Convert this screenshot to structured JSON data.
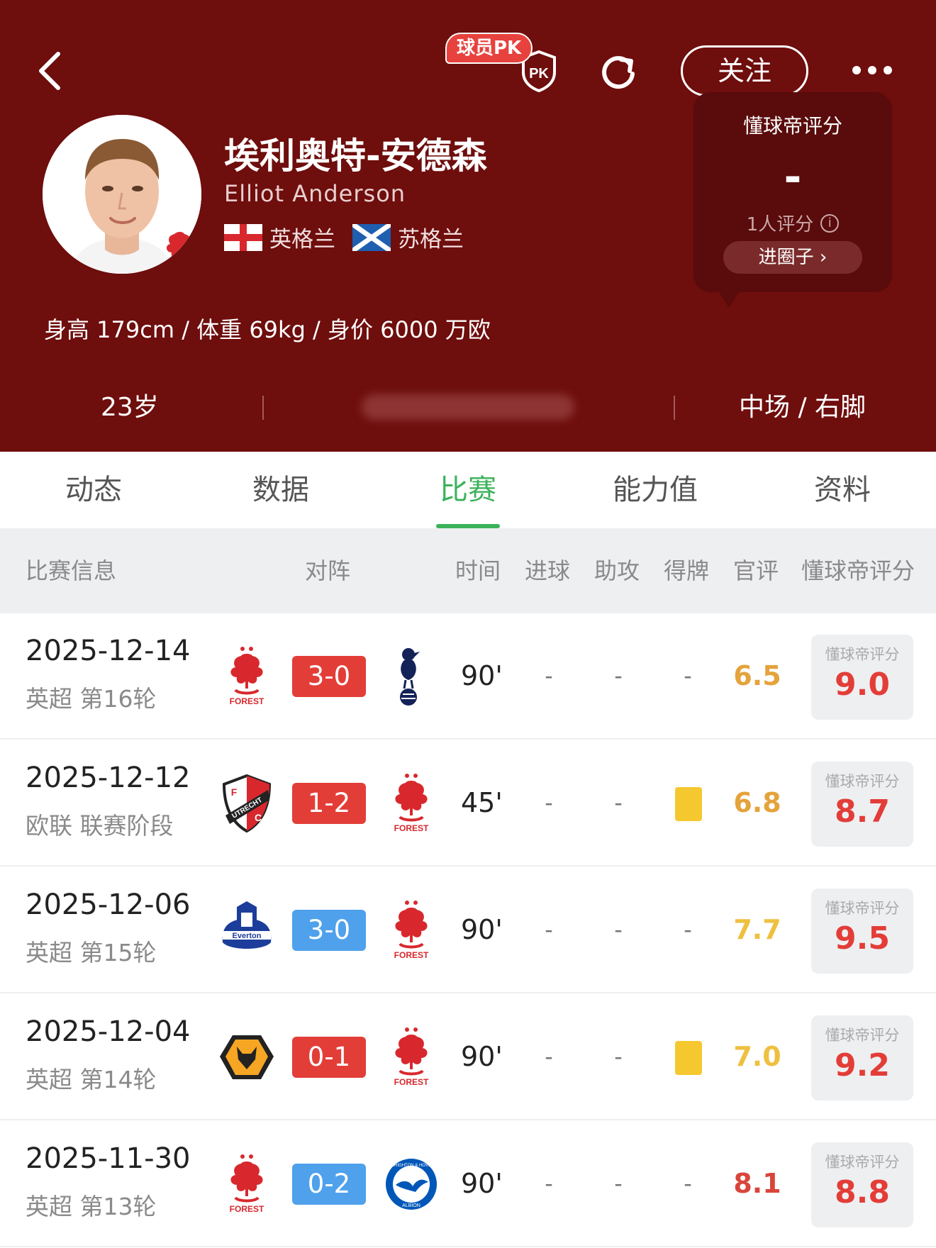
{
  "header": {
    "pk_badge": "球员PK",
    "pk_icon_text": "PK",
    "follow_label": "关注",
    "name_cn": "埃利奥特-安德森",
    "name_en": "Elliot Anderson",
    "nation1": "英格兰",
    "nation2": "苏格兰",
    "physical": "身高 179cm / 体重 69kg / 身价 6000 万欧",
    "age": "23岁",
    "position": "中场 / 右脚",
    "club_badge_text": "FOREST"
  },
  "rating_box": {
    "title": "懂球帝评分",
    "value": "-",
    "count": "1人评分",
    "info_icon": "i",
    "button": "进圈子 ›"
  },
  "tabs": [
    {
      "label": "动态"
    },
    {
      "label": "数据"
    },
    {
      "label": "比赛"
    },
    {
      "label": "能力值"
    },
    {
      "label": "资料"
    }
  ],
  "table_header": {
    "info": "比赛信息",
    "matchup": "对阵",
    "time": "时间",
    "goals": "进球",
    "assists": "助攻",
    "cards": "得牌",
    "official": "官评",
    "dqd": "懂球帝评分"
  },
  "rating_label": "懂球帝评分",
  "colors": {
    "header_bg": "#6e0e0d",
    "accent_green": "#3bb25a",
    "score_loss": "#e33d38",
    "score_win": "#4fa1ec",
    "yellow_card": "#f6c82f"
  },
  "matches": [
    {
      "date": "2025-12-14",
      "comp": "英超 第16轮",
      "home": "forest",
      "away": "spurs",
      "score": "3-0",
      "score_color": "red",
      "time": "90'",
      "goals": "-",
      "assists": "-",
      "card": "-",
      "official": "6.5",
      "official_color": "#e4a33b",
      "rating": "9.0"
    },
    {
      "date": "2025-12-12",
      "comp": "欧联 联赛阶段",
      "home": "utrecht",
      "away": "forest",
      "score": "1-2",
      "score_color": "red",
      "time": "45'",
      "goals": "-",
      "assists": "-",
      "card": "yellow",
      "official": "6.8",
      "official_color": "#e4a33b",
      "rating": "8.7"
    },
    {
      "date": "2025-12-06",
      "comp": "英超 第15轮",
      "home": "everton",
      "away": "forest",
      "score": "3-0",
      "score_color": "blue",
      "time": "90'",
      "goals": "-",
      "assists": "-",
      "card": "-",
      "official": "7.7",
      "official_color": "#efc040",
      "rating": "9.5"
    },
    {
      "date": "2025-12-04",
      "comp": "英超 第14轮",
      "home": "wolves",
      "away": "forest",
      "score": "0-1",
      "score_color": "red",
      "time": "90'",
      "goals": "-",
      "assists": "-",
      "card": "yellow",
      "official": "7.0",
      "official_color": "#efc040",
      "rating": "9.2"
    },
    {
      "date": "2025-11-30",
      "comp": "英超 第13轮",
      "home": "forest",
      "away": "brighton",
      "score": "0-2",
      "score_color": "blue",
      "time": "90'",
      "goals": "-",
      "assists": "-",
      "card": "-",
      "official": "8.1",
      "official_color": "#d9453b",
      "rating": "8.8"
    }
  ],
  "team_logo_text": {
    "forest": "FOREST",
    "utrecht": "UTRECHT",
    "utrecht_letters": "F C",
    "everton": "Everton",
    "brighton_top": "BRIGHTON & HOVE",
    "brighton_bottom": "ALBION"
  }
}
